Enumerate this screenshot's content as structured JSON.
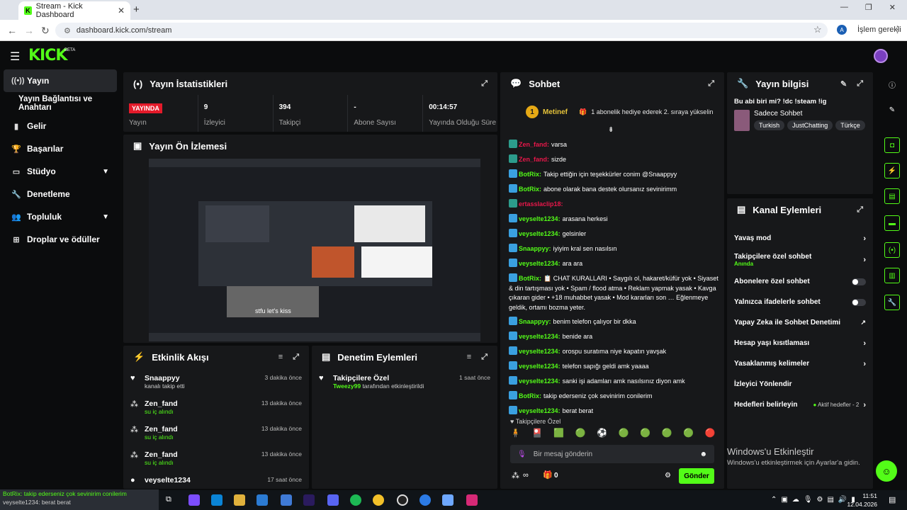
{
  "browser": {
    "tab_title": "Stream - Kick Dashboard",
    "url": "dashboard.kick.com/stream",
    "profile_initial": "A",
    "pill_label": "İşlem gerekli"
  },
  "header": {
    "logo": "KICK",
    "beta": "BETA"
  },
  "sidebar": {
    "items": [
      {
        "label": "Yayın",
        "icon": "broadcast-icon"
      },
      {
        "label": "Yayın Bağlantısı ve Anahtarı"
      },
      {
        "label": "Gelir",
        "icon": "chart-icon"
      },
      {
        "label": "Başarılar",
        "icon": "trophy-icon"
      },
      {
        "label": "Stüdyo",
        "icon": "studio-icon"
      },
      {
        "label": "Denetleme",
        "icon": "wrench-icon"
      },
      {
        "label": "Topluluk",
        "icon": "people-icon"
      },
      {
        "label": "Droplar ve ödüller",
        "icon": "gift-icon"
      }
    ]
  },
  "stats": {
    "title": "Yayın İstatistikleri",
    "live_badge": "YAYINDA",
    "live_label": "Yayın",
    "viewers": "9",
    "viewers_label": "İzleyici",
    "followers": "394",
    "followers_label": "Takipçi",
    "subs": "-",
    "subs_label": "Abone Sayısı",
    "uptime": "00:14:57",
    "uptime_label": "Yayında Olduğu Süre"
  },
  "preview": {
    "title": "Yayın Ön İzlemesi",
    "caption": "stfu let's kiss"
  },
  "activity": {
    "title": "Etkinlik Akışı",
    "items": [
      {
        "name": "Snaappyy",
        "desc": "kanalı takip etti",
        "time": "3 dakika önce",
        "green": false
      },
      {
        "name": "Zen_fand",
        "desc": "su iç alındı",
        "time": "13 dakika önce",
        "green": true
      },
      {
        "name": "Zen_fand",
        "desc": "su iç alındı",
        "time": "13 dakika önce",
        "green": true
      },
      {
        "name": "Zen_fand",
        "desc": "su iç alındı",
        "time": "13 dakika önce",
        "green": true
      },
      {
        "name": "veyselte1234",
        "desc": "",
        "time": "17 saat önce",
        "green": false
      }
    ]
  },
  "moderation": {
    "title": "Denetim Eylemleri",
    "item_name": "Takipçilere Özel",
    "item_user": "Tweezy99",
    "item_desc": "tarafından etkinleştirildi",
    "item_time": "1 saat önce"
  },
  "chat": {
    "title": "Sohbet",
    "pinned_name": "Metinef",
    "pinned_count": "1",
    "pinned_text": "1 abonelik hediye ederek 2. sıraya yükselin",
    "messages": [
      {
        "user": "Zen_fand",
        "color": "#e8174a",
        "text": "varsa"
      },
      {
        "user": "Zen_fand",
        "color": "#e8174a",
        "text": "sizde"
      },
      {
        "user": "BotRix",
        "color": "#53fc18",
        "text": "Takip ettiğin için teşekkürler conim @Snaappyy"
      },
      {
        "user": "BotRix",
        "color": "#53fc18",
        "text": "abone olarak bana destek olursanız sevinirimm"
      },
      {
        "user": "ertasslaclip18",
        "color": "#e8174a",
        "text": ""
      },
      {
        "user": "veyselte1234",
        "color": "#53fc18",
        "text": "arasana herkesi"
      },
      {
        "user": "veyselte1234",
        "color": "#53fc18",
        "text": "gelsinler"
      },
      {
        "user": "Snaappyy",
        "color": "#53fc18",
        "text": "iyiyim kral sen nasılsın"
      },
      {
        "user": "veyselte1234",
        "color": "#53fc18",
        "text": "ara ara"
      },
      {
        "user": "BotRix",
        "color": "#53fc18",
        "text": "📋 CHAT KURALLARI • Saygılı ol, hakaret/küfür yok • Siyaset & din tartışması yok • Spam / flood atma • Reklam yapmak yasak • Kavga çıkaran gider • +18 muhabbet yasak • Mod kararları son … Eğlenmeye geldik, ortamı bozma yeter."
      },
      {
        "user": "Snaappyy",
        "color": "#53fc18",
        "text": "benim telefon çalıyor bir dkka"
      },
      {
        "user": "veyselte1234",
        "color": "#53fc18",
        "text": "benide ara"
      },
      {
        "user": "veyselte1234",
        "color": "#53fc18",
        "text": "orospu suratıma niye kapatın yavşak"
      },
      {
        "user": "veyselte1234",
        "color": "#53fc18",
        "text": "telefon sapığı geldi amk yaaaa"
      },
      {
        "user": "veyselte1234",
        "color": "#53fc18",
        "text": "sanki işi adamları amk nasılsınız diyon amk"
      },
      {
        "user": "BotRix",
        "color": "#53fc18",
        "text": "takip ederseniz çok sevinirim conilerim"
      },
      {
        "user": "veyselte1234",
        "color": "#53fc18",
        "text": "berat berat"
      }
    ],
    "followers_only": "Takipçilere Özel",
    "input_placeholder": "Bir mesaj gönderin",
    "points": "∞",
    "gifts": "0",
    "send_label": "Gönder"
  },
  "info": {
    "title": "Yayın bilgisi",
    "stream_title": "Bu abi biri mi? !dc !steam !ig",
    "category": "Sadece Sohbet",
    "tags": [
      "Turkish",
      "JustChatting",
      "Türkçe"
    ]
  },
  "actions": {
    "title": "Kanal Eylemleri",
    "items": [
      {
        "label": "Yavaş mod",
        "kind": "arrow"
      },
      {
        "label": "Takipçilere özel sohbet",
        "sub": "Anında",
        "kind": "arrow"
      },
      {
        "label": "Abonelere özel sohbet",
        "kind": "toggle"
      },
      {
        "label": "Yalnızca ifadelerle sohbet",
        "kind": "toggle"
      },
      {
        "label": "Yapay Zeka ile Sohbet Denetimi",
        "kind": "ext"
      },
      {
        "label": "Hesap yaşı kısıtlaması",
        "kind": "arrow"
      },
      {
        "label": "Yasaklanmış kelimeler",
        "kind": "arrow"
      },
      {
        "label": "İzleyici Yönlendir",
        "kind": "none"
      },
      {
        "label": "Hedefleri belirleyin",
        "sub": "Aktif hedefler - 2",
        "kind": "arrow"
      }
    ]
  },
  "windows": {
    "activate_title": "Windows'u Etkinleştir",
    "activate_sub": "Windows'u etkinleştirmek için Ayarlar'a gidin.",
    "time": "11:51",
    "date": "12.04.2026",
    "thumb_line1": "BotRix: takip ederseniz çok sevinirim conilerim",
    "thumb_line2": "veyselte1234: berat berat"
  },
  "colors": {
    "accent": "#53fc18",
    "live": "#e41a2a",
    "panel": "#17181a",
    "bg": "#0b0c0d"
  }
}
